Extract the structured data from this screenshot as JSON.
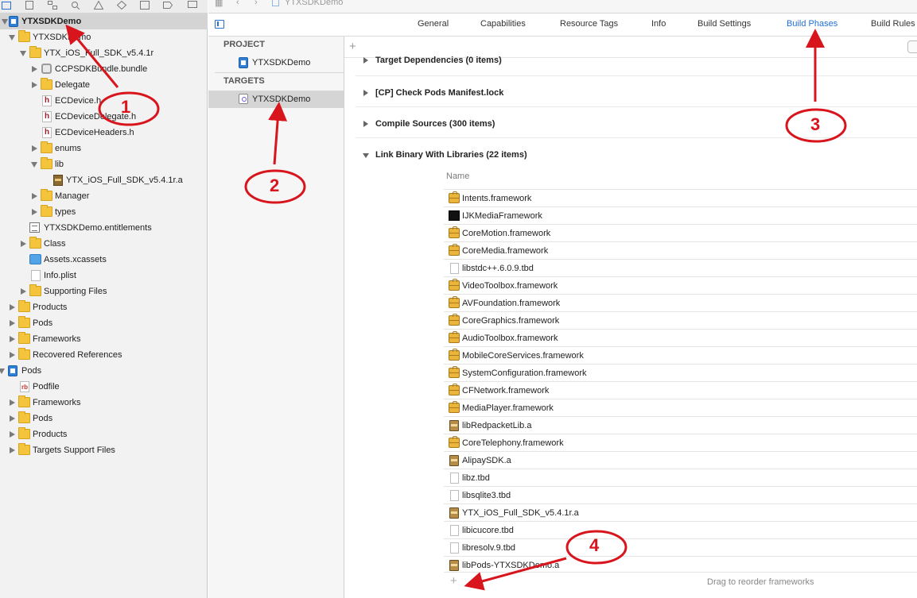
{
  "jumpbar": {
    "project": "YTXSDKDemo"
  },
  "tabs": [
    "General",
    "Capabilities",
    "Resource Tags",
    "Info",
    "Build Settings",
    "Build Phases",
    "Build Rules"
  ],
  "navigator": {
    "items": [
      "YTXSDKDemo",
      "YTXSDKDemo",
      "YTX_iOS_Full_SDK_v5.4.1r",
      "CCPSDKBundle.bundle",
      "Delegate",
      "ECDevice.h",
      "ECDeviceDelegate.h",
      "ECDeviceHeaders.h",
      "enums",
      "lib",
      "YTX_iOS_Full_SDK_v5.4.1r.a",
      "Manager",
      "types",
      "YTXSDKDemo.entitlements",
      "Class",
      "Assets.xcassets",
      "Info.plist",
      "Supporting Files",
      "Products",
      "Pods",
      "Frameworks",
      "Recovered References",
      "Pods",
      "Podfile",
      "Frameworks",
      "Pods",
      "Products",
      "Targets Support Files"
    ]
  },
  "target_list": {
    "project_header": "PROJECT",
    "project_item": "YTXSDKDemo",
    "targets_header": "TARGETS",
    "target_item": "YTXSDKDemo"
  },
  "phases": {
    "items": [
      "Target Dependencies (0 items)",
      "[CP] Check Pods Manifest.lock",
      "Compile Sources (300 items)",
      "Link Binary With Libraries (22 items)"
    ],
    "column_name": "Name",
    "libraries": [
      "Intents.framework",
      "IJKMediaFramework",
      "CoreMotion.framework",
      "CoreMedia.framework",
      "libstdc++.6.0.9.tbd",
      "VideoToolbox.framework",
      "AVFoundation.framework",
      "CoreGraphics.framework",
      "AudioToolbox.framework",
      "MobileCoreServices.framework",
      "SystemConfiguration.framework",
      "CFNetwork.framework",
      "MediaPlayer.framework",
      "libRedpacketLib.a",
      "CoreTelephony.framework",
      "AlipaySDK.a",
      "libz.tbd",
      "libsqlite3.tbd",
      "YTX_iOS_Full_SDK_v5.4.1r.a",
      "libicucore.tbd",
      "libresolv.9.tbd",
      "libPods-YTXSDKDemo.a"
    ],
    "drag_hint": "Drag to reorder frameworks"
  },
  "annotations": [
    "1",
    "2",
    "3",
    "4"
  ],
  "colors": {
    "accent": "#1f6fd6",
    "annotation": "#d8141c",
    "folder": "#f4c43d"
  }
}
